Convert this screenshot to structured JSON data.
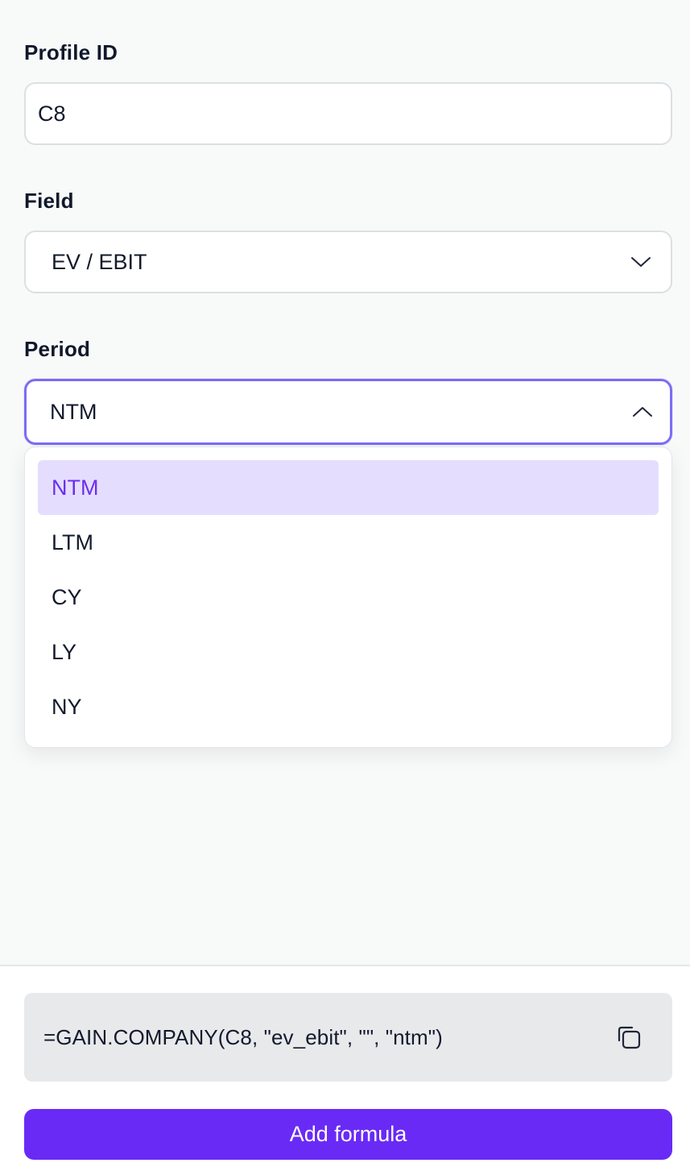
{
  "profile": {
    "label": "Profile ID",
    "value": "C8"
  },
  "field": {
    "label": "Field",
    "value": "EV / EBIT",
    "icon": "chevron-down-icon"
  },
  "period": {
    "label": "Period",
    "value": "NTM",
    "icon": "chevron-up-icon",
    "options": [
      "NTM",
      "LTM",
      "CY",
      "LY",
      "NY"
    ],
    "selected_index": 0
  },
  "formula": {
    "text": "=GAIN.COMPANY(C8, \"ev_ebit\", \"\", \"ntm\")",
    "copy_icon": "copy-icon"
  },
  "actions": {
    "add_label": "Add formula"
  },
  "colors": {
    "accent": "#6a2af5",
    "focus_border": "#7b6cf6",
    "selected_option_bg": "#e5ddfd",
    "selected_option_text": "#6a2ef2"
  }
}
